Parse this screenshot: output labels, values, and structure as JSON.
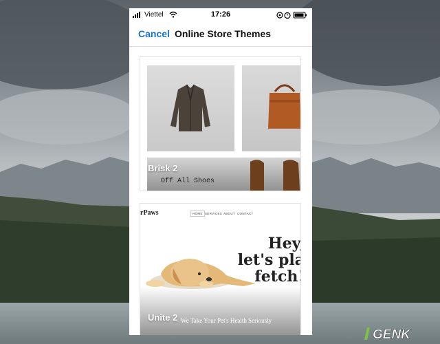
{
  "status_bar": {
    "carrier": "Viettel",
    "time": "17:26"
  },
  "nav": {
    "cancel_label": "Cancel",
    "title": "Online Store Themes"
  },
  "themes": [
    {
      "name": "Brisk 2",
      "preview_text": "Off All Shoes"
    },
    {
      "name": "Unite 2",
      "logo": "rPaws",
      "nav_items": [
        "HOME",
        "SERVICES",
        "ABOUT",
        "CONTACT"
      ],
      "hero_lines": [
        "Hey,",
        "let's pla",
        "fetch!"
      ],
      "tagline": "We Take Your Pet's Health Seriously"
    }
  ],
  "watermark": "GENK",
  "colors": {
    "accent": "#1a73c8",
    "watermark_green": "#7dc242"
  }
}
